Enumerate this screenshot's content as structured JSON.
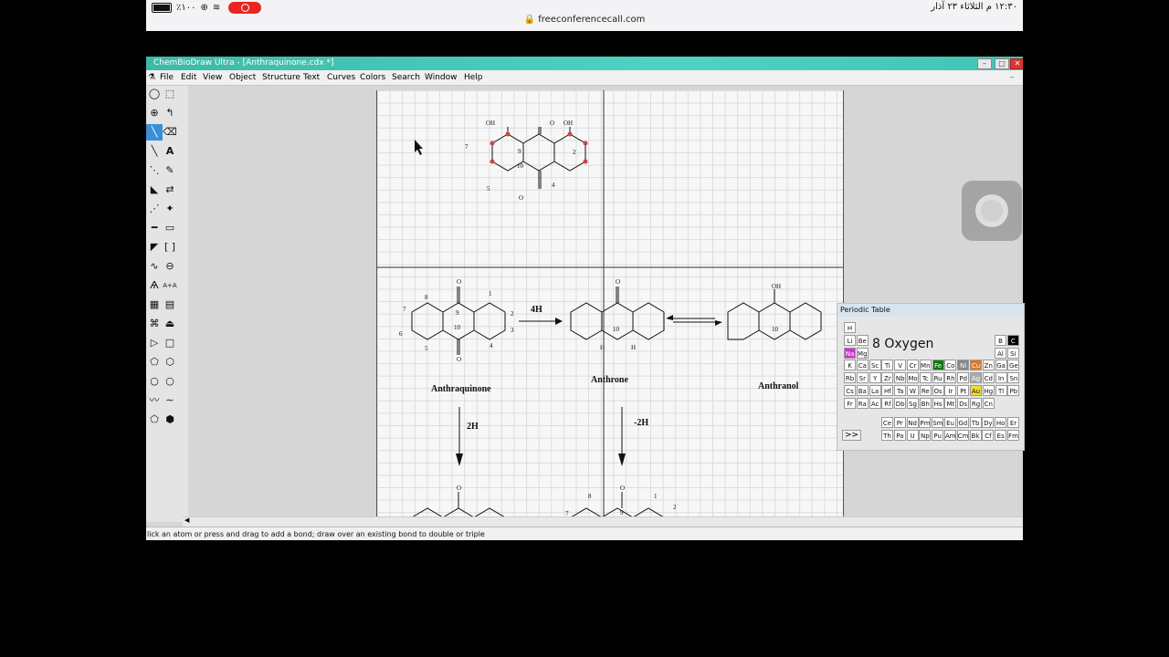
{
  "ipad": {
    "battery": "٪١٠٠",
    "url": "freeconferencecall.com",
    "datetime": "١٢:٣٠ م  الثلاثاء ٢٣ آذار"
  },
  "window": {
    "title": "ChemBioDraw Ultra - [Anthraquinone.cdx *]"
  },
  "menu": [
    "File",
    "Edit",
    "View",
    "Object",
    "Structure",
    "Text",
    "Curves",
    "Colors",
    "Search",
    "Window",
    "Help"
  ],
  "status": "lick an atom or press and drag to add a bond; draw over an existing bond to double or triple",
  "molecules": {
    "top": {
      "oh1": "OH",
      "oh2": "OH",
      "o_top": "O",
      "o_bot": "O",
      "n7": "7",
      "n9": "9",
      "n10": "10",
      "n2": "2",
      "n5": "5",
      "n4": "4"
    },
    "anthraquinone": {
      "name": "Anthraquinone",
      "n8": "8",
      "n1": "1",
      "n7": "7",
      "n2": "2",
      "n9": "9",
      "n10": "10",
      "n6": "6",
      "n3": "3",
      "n5": "5",
      "n4": "4",
      "o": "O"
    },
    "anthrone": {
      "name": "Anthrone",
      "n10": "10",
      "h": "H",
      "o": "O"
    },
    "anthranol": {
      "name": "Anthranol",
      "oh": "OH",
      "n10": "10"
    },
    "arrows": {
      "a4h": "4H",
      "a2h": "2H",
      "am2h": "-2H"
    },
    "bottom": {
      "o": "O",
      "n8": "8",
      "n1": "1",
      "n2": "2",
      "n7": "7",
      "n9": "9"
    }
  },
  "periodic_table": {
    "title": "Periodic Table",
    "selected": "8  Oxygen",
    "more": ">>",
    "rows": [
      [
        "H"
      ],
      [
        "Li",
        "Be"
      ],
      [
        "Na",
        "Mg"
      ],
      [
        "K",
        "Ca",
        "Sc",
        "Ti",
        "V",
        "Cr",
        "Mn",
        "Fe",
        "Co",
        "Ni",
        "Cu",
        "Zn",
        "Ga",
        "Ge"
      ],
      [
        "Rb",
        "Sr",
        "Y",
        "Zr",
        "Nb",
        "Mo",
        "Tc",
        "Ru",
        "Rh",
        "Pd",
        "Ag",
        "Cd",
        "In",
        "Sn"
      ],
      [
        "Cs",
        "Ba",
        "La",
        "Hf",
        "Ta",
        "W",
        "Re",
        "Os",
        "Ir",
        "Pt",
        "Au",
        "Hg",
        "Tl",
        "Pb"
      ],
      [
        "Fr",
        "Ra",
        "Ac",
        "Rf",
        "Db",
        "Sg",
        "Bh",
        "Hs",
        "Mt",
        "Ds",
        "Rg",
        "Cn"
      ]
    ],
    "p_block": [
      "B",
      "C",
      "Al",
      "Si"
    ],
    "lanthanides": [
      "Ce",
      "Pr",
      "Nd",
      "Pm",
      "Sm",
      "Eu",
      "Gd",
      "Tb",
      "Dy",
      "Ho",
      "Er"
    ],
    "actinides": [
      "Th",
      "Pa",
      "U",
      "Np",
      "Pu",
      "Am",
      "Cm",
      "Bk",
      "Cf",
      "Es",
      "Fm"
    ],
    "colors": {
      "Na": "#cc33cc",
      "Fe": "#117711",
      "Ni": "#888888",
      "Cu": "#dd7722",
      "Ag": "#aaaaaa",
      "Au": "#eedd33",
      "C": "#000000"
    }
  }
}
